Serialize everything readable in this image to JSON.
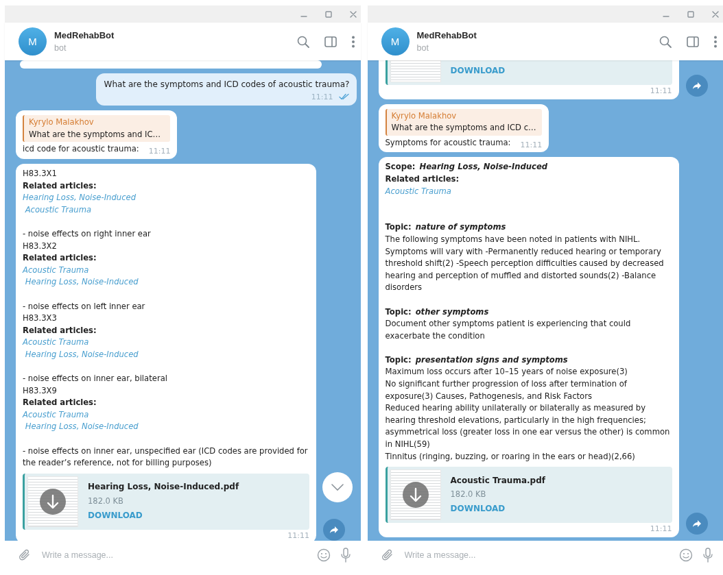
{
  "windows": [
    {
      "scroll_down_button": true,
      "chat": {
        "avatar_letter": "M",
        "name": "MedRehabBot",
        "status": "bot"
      },
      "messages": [
        {
          "kind": "partial"
        },
        {
          "kind": "outgoing",
          "text": "What are the symptoms and ICD codes of acoustic trauma?",
          "time": "11:11",
          "read": true
        },
        {
          "kind": "reply",
          "quote_author": "Kyrylo Malakhov",
          "quote_text": "What are the symptoms and IC…",
          "text": "icd code for acoustic trauma:",
          "time": "11:11"
        },
        {
          "kind": "rich",
          "forward": true,
          "time": "11:11",
          "file": {
            "name": "Hearing Loss, Noise-Induced.pdf",
            "size": "182.0 KB",
            "action": "DOWNLOAD"
          },
          "blocks": [
            {
              "kind": "text",
              "text": "H83.3X1"
            },
            {
              "kind": "bold",
              "text": "Related articles:"
            },
            {
              "kind": "link",
              "text": "Hearing Loss, Noise-Induced"
            },
            {
              "kind": "link",
              "text": " Acoustic Trauma"
            },
            {
              "kind": "gap"
            },
            {
              "kind": "text",
              "text": "- noise effects on right inner ear"
            },
            {
              "kind": "text",
              "text": "H83.3X2"
            },
            {
              "kind": "bold",
              "text": "Related articles:"
            },
            {
              "kind": "link",
              "text": "Acoustic Trauma"
            },
            {
              "kind": "link",
              "text": " Hearing Loss, Noise-Induced"
            },
            {
              "kind": "gap"
            },
            {
              "kind": "text",
              "text": "- noise effects on left inner ear"
            },
            {
              "kind": "text",
              "text": "H83.3X3"
            },
            {
              "kind": "bold",
              "text": "Related articles:"
            },
            {
              "kind": "link",
              "text": "Acoustic Trauma"
            },
            {
              "kind": "link",
              "text": " Hearing Loss, Noise-Induced"
            },
            {
              "kind": "gap"
            },
            {
              "kind": "text",
              "text": "- noise effects on inner ear, bilateral"
            },
            {
              "kind": "text",
              "text": "H83.3X9"
            },
            {
              "kind": "bold",
              "text": "Related articles:"
            },
            {
              "kind": "link",
              "text": "Acoustic Trauma"
            },
            {
              "kind": "link",
              "text": " Hearing Loss, Noise-Induced"
            },
            {
              "kind": "gap"
            },
            {
              "kind": "text",
              "text": "- noise effects on inner ear, unspecified ear (ICD codes are provided for the reader’s reference, not for billing purposes)"
            }
          ]
        }
      ],
      "composer": {
        "placeholder": "Write a message..."
      }
    },
    {
      "scroll_down_button": false,
      "chat": {
        "avatar_letter": "M",
        "name": "MedRehabBot",
        "status": "bot"
      },
      "messages": [
        {
          "kind": "file_tail",
          "forward": true,
          "time": "11:11",
          "file": {
            "action": "DOWNLOAD"
          }
        },
        {
          "kind": "reply",
          "quote_author": "Kyrylo Malakhov",
          "quote_text": "What are the symptoms and ICD c…",
          "text": "Symptoms for acoustic trauma:",
          "time": "11:11"
        },
        {
          "kind": "rich",
          "forward": true,
          "time": "11:11",
          "file": {
            "name": "Acoustic Trauma.pdf",
            "size": "182.0 KB",
            "action": "DOWNLOAD"
          },
          "blocks": [
            {
              "kind": "topic",
              "label": "Scope:",
              "value": "Hearing Loss, Noise-Induced"
            },
            {
              "kind": "bold",
              "text": "Related articles:"
            },
            {
              "kind": "link",
              "text": "Acoustic Trauma"
            },
            {
              "kind": "gap"
            },
            {
              "kind": "gap"
            },
            {
              "kind": "topic",
              "label": "Topic:",
              "value": "nature of symptoms"
            },
            {
              "kind": "text",
              "text": "The following symptoms have been noted in patients with NIHL. Symptoms will vary with -Permanently reduced hearing or temporary threshold shift(2) -Speech perception difficulties caused by decreased hearing and perception of muffled and distorted sounds(2) -Balance disorders"
            },
            {
              "kind": "gap"
            },
            {
              "kind": "topic",
              "label": "Topic:",
              "value": "other symptoms"
            },
            {
              "kind": "text",
              "text": "Document other symptoms patient is experiencing that could exacerbate the condition"
            },
            {
              "kind": "gap"
            },
            {
              "kind": "topic",
              "label": "Topic:",
              "value": "presentation signs and symptoms"
            },
            {
              "kind": "text",
              "text": "Maximum loss occurs after 10–15 years of noise exposure(3)"
            },
            {
              "kind": "text",
              "text": "No significant further progression of loss after termination of exposure(3) Causes, Pathogenesis, and Risk Factors"
            },
            {
              "kind": "text",
              "text": "Reduced hearing ability unilaterally or bilaterally as measured by hearing threshold elevations, particularly in the high frequencies; asymmetrical loss (greater loss in one ear versus the other) is common in NIHL(59)"
            },
            {
              "kind": "text",
              "text": "Tinnitus (ringing, buzzing, or roaring in the ears or head)(2,66)"
            }
          ]
        }
      ],
      "composer": {
        "placeholder": "Write a message..."
      }
    }
  ]
}
